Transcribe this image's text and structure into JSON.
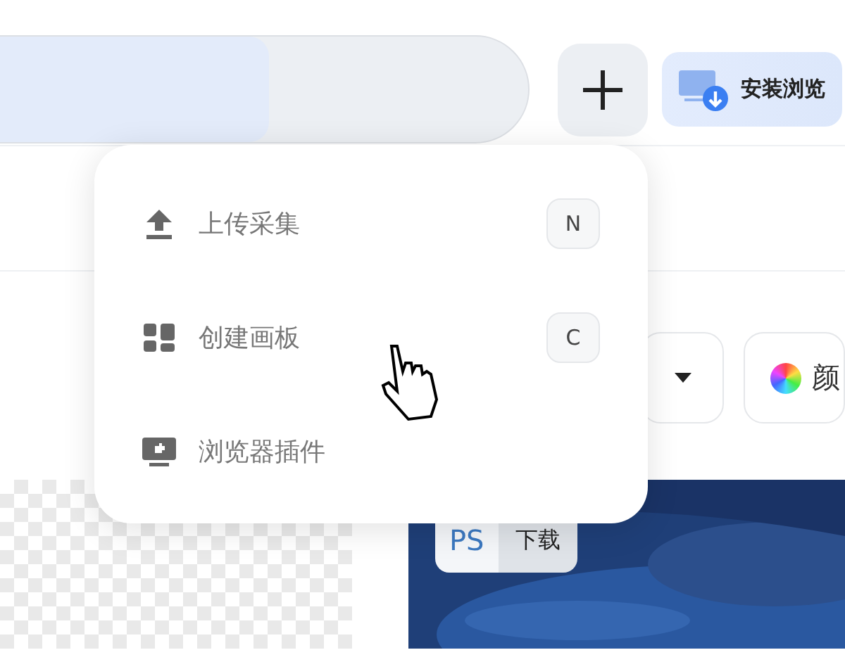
{
  "toolbar": {
    "install_button": {
      "label": "安装浏览"
    }
  },
  "menu": {
    "items": [
      {
        "kind": "upload",
        "label": "上传采集",
        "shortcut": "N"
      },
      {
        "kind": "board",
        "label": "创建画板",
        "shortcut": "C"
      },
      {
        "kind": "plugin",
        "label": "浏览器插件"
      }
    ]
  },
  "filters": [
    {
      "kind": "dropdown"
    },
    {
      "kind": "color",
      "label": "颜"
    }
  ],
  "cards": [
    {
      "kind": "transparent"
    },
    {
      "kind": "picture",
      "format": "PS",
      "action": "下载"
    }
  ]
}
